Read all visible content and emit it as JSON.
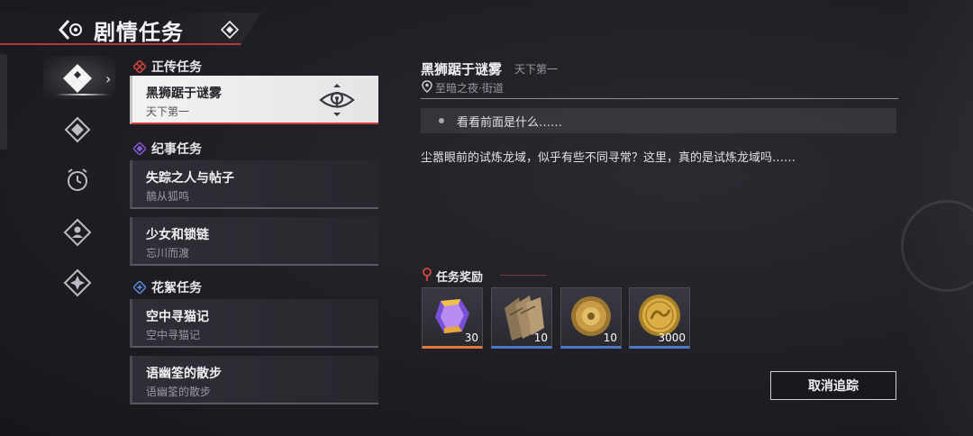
{
  "header": {
    "title": "剧情任务"
  },
  "sections": [
    {
      "title": "正传任务",
      "icon": "main-quest-icon",
      "color": "#d9463e",
      "quests": [
        {
          "title": "黑狮踞于谜雾",
          "subtitle": "天下第一",
          "active": true
        }
      ]
    },
    {
      "title": "纪事任务",
      "icon": "chronicle-quest-icon",
      "color": "#8a5ad6",
      "quests": [
        {
          "title": "失踪之人与帖子",
          "subtitle": "鶄从狐鸣"
        },
        {
          "title": "少女和锁链",
          "subtitle": "忘川而渡"
        }
      ]
    },
    {
      "title": "花絮任务",
      "icon": "side-quest-icon",
      "color": "#5a8ce0",
      "quests": [
        {
          "title": "空中寻猫记",
          "subtitle": "空中寻猫记"
        },
        {
          "title": "语幽筌的散步",
          "subtitle": "语幽筌的散步"
        }
      ]
    }
  ],
  "detail": {
    "title": "黑狮踞于谜雾",
    "subtitle": "天下第一",
    "location": "至暗之夜·街道",
    "objective": "看看前面是什么……",
    "description": "尘嚣眼前的试炼龙域，似乎有些不同寻常？这里，真的是试炼龙域吗……",
    "rewards_heading": "任务奖励",
    "rewards": [
      {
        "item": "purple-crystal-icon",
        "quantity": "30",
        "rarity": "orange"
      },
      {
        "item": "wooden-planks-icon",
        "quantity": "10",
        "rarity": "blue"
      },
      {
        "item": "bronze-shield-icon",
        "quantity": "10",
        "rarity": "blue"
      },
      {
        "item": "gold-coin-icon",
        "quantity": "3000",
        "rarity": "blue"
      }
    ],
    "untrack_label": "取消追踪"
  },
  "colors": {
    "accent_red": "#d8383a",
    "panel": "#2f2e36"
  }
}
